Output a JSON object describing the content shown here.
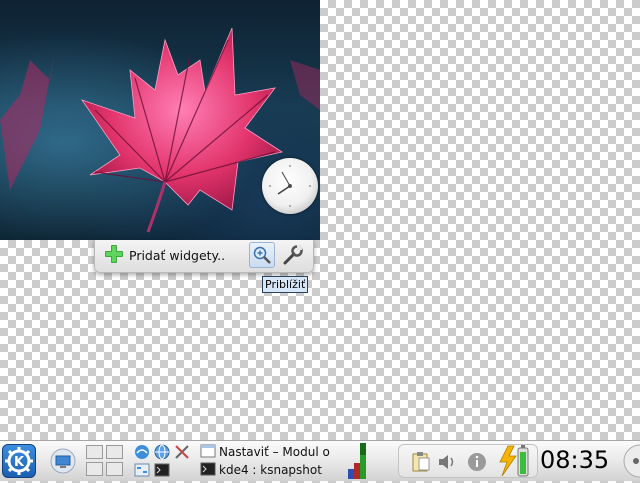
{
  "desktop": {
    "toolbox": {
      "add_widgets_label": "Pridať widgety..",
      "zoom_tooltip": "Priblížiť"
    }
  },
  "panel": {
    "tasks": [
      {
        "label": "Nastaviť – Modul o",
        "icon": "window-icon"
      },
      {
        "label": "kde4 : ksnapshot",
        "icon": "terminal-icon"
      }
    ],
    "clock": "08:35",
    "colors": {
      "kde_blue": "#2a73c9",
      "battery_green": "#3cbc3c",
      "flash_yellow": "#f4b400"
    }
  }
}
